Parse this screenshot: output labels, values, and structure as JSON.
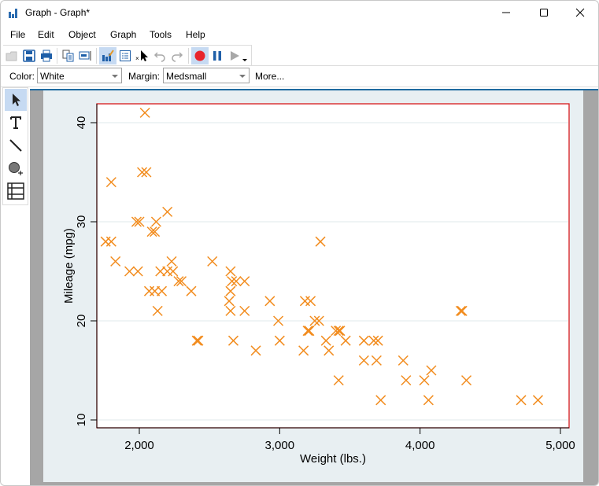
{
  "window": {
    "title": "Graph - Graph*",
    "controls": {
      "minimize": "minimize-icon",
      "maximize": "maximize-icon",
      "close": "close-icon"
    }
  },
  "menu": [
    "File",
    "Edit",
    "Object",
    "Graph",
    "Tools",
    "Help"
  ],
  "toolbar": {
    "buttons": [
      {
        "name": "open",
        "icon": "folder-icon",
        "enabled": false
      },
      {
        "name": "save",
        "icon": "save-icon",
        "enabled": true
      },
      {
        "name": "print",
        "icon": "print-icon",
        "enabled": true
      },
      {
        "name": "copy",
        "icon": "copy-icon",
        "enabled": true
      },
      {
        "name": "rename",
        "icon": "rename-icon",
        "enabled": true
      },
      {
        "name": "graph-editor",
        "icon": "graph-edit-icon",
        "active": true
      },
      {
        "name": "object-browser",
        "icon": "list-icon",
        "enabled": true
      },
      {
        "name": "deselect",
        "icon": "deselect-pointer-icon",
        "enabled": true
      },
      {
        "name": "undo",
        "icon": "undo-icon",
        "enabled": false
      },
      {
        "name": "redo",
        "icon": "redo-icon",
        "enabled": false
      },
      {
        "name": "record",
        "icon": "record-icon",
        "active": true
      },
      {
        "name": "pause",
        "icon": "pause-icon",
        "enabled": true
      },
      {
        "name": "play",
        "icon": "play-icon",
        "enabled": false
      }
    ]
  },
  "properties": {
    "color_label": "Color:",
    "color_value": "White",
    "margin_label": "Margin:",
    "margin_value": "Medsmall",
    "more_label": "More..."
  },
  "tools": [
    "pointer-tool",
    "text-tool",
    "line-tool",
    "marker-tool",
    "grid-tool"
  ],
  "colors": {
    "marker": "#f28c1e",
    "plot_border": "#d7191c",
    "graph_bg": "#e8eff2",
    "accent": "#c6daf2"
  },
  "chart_data": {
    "type": "scatter",
    "title": "",
    "xlabel": "Weight (lbs.)",
    "ylabel": "Mileage (mpg)",
    "xlim": [
      1700,
      5050
    ],
    "ylim": [
      8.5,
      41.5
    ],
    "xticks": [
      2000,
      3000,
      4000,
      5000
    ],
    "xtick_labels": [
      "2,000",
      "3,000",
      "4,000",
      "5,000"
    ],
    "yticks": [
      10,
      20,
      30,
      40
    ],
    "ytick_labels": [
      "10",
      "20",
      "30",
      "40"
    ],
    "grid": "horizontal",
    "legend": "none",
    "marker": "x",
    "series": [
      {
        "name": "mpg",
        "x": [
          2930,
          3350,
          2640,
          3250,
          4080,
          3670,
          2230,
          3280,
          3880,
          3400,
          4330,
          3900,
          4290,
          2110,
          3690,
          3180,
          3220,
          2750,
          3430,
          2120,
          3600,
          3600,
          1800,
          2650,
          4060,
          3720,
          2200,
          2520,
          3330,
          3700,
          3470,
          3210,
          3200,
          3420,
          2690,
          2830,
          2070,
          2650,
          2370,
          2020,
          2280,
          2750,
          2130,
          2240,
          1760,
          1980,
          3420,
          1830,
          2050,
          2410,
          2200,
          2670,
          2160,
          2040,
          1930,
          1990,
          3170,
          3210,
          2420,
          2650,
          4030,
          2990,
          4300,
          3290,
          3000,
          2300,
          2000,
          2150,
          2110,
          4720,
          4840,
          2090,
          2660,
          1800
        ],
        "y": [
          22,
          17,
          22,
          20,
          15,
          18,
          26,
          20,
          16,
          19,
          14,
          14,
          21,
          29,
          16,
          22,
          22,
          24,
          19,
          30,
          18,
          16,
          28,
          21,
          12,
          12,
          25,
          26,
          18,
          18,
          18,
          19,
          19,
          19,
          24,
          17,
          23,
          25,
          23,
          35,
          24,
          21,
          21,
          25,
          28,
          30,
          14,
          26,
          35,
          18,
          31,
          18,
          23,
          41,
          25,
          25,
          17,
          19,
          18,
          23,
          14,
          20,
          21,
          28,
          18,
          24,
          30,
          25,
          23,
          12,
          12,
          29,
          24,
          34
        ]
      }
    ]
  }
}
